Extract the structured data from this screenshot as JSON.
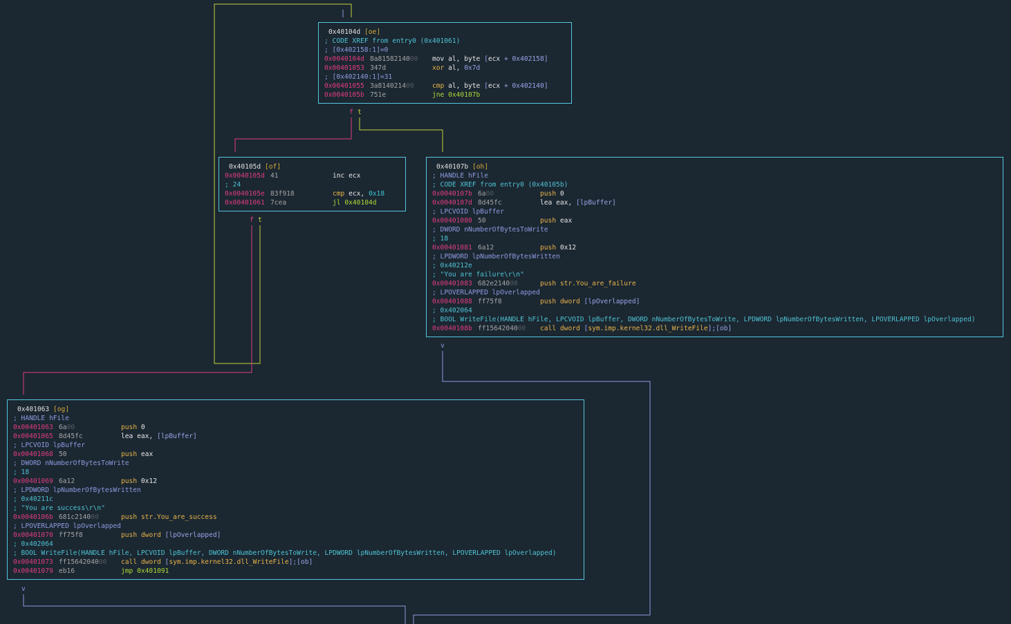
{
  "nodes": [
    {
      "id": "oe",
      "header": {
        "addr": "0x40104d",
        "label": "[oe]"
      },
      "lines": [
        {
          "t": "c",
          "text": "; CODE XREF from entry0 (0x401061)"
        },
        {
          "t": "c",
          "text": "; [0x402158:1]=0",
          "dim": true
        },
        {
          "t": "i",
          "off": "0x0040104d",
          "bytes": "8a81582140",
          "z": "00",
          "mn": "mov",
          "mcls": "op-w",
          "args": [
            [
              "al, byte ",
              "op-w"
            ],
            [
              "[",
              "br"
            ],
            [
              "ecx",
              "op-w"
            ],
            [
              " + ",
              "br"
            ],
            [
              "0x402158",
              "br"
            ],
            [
              "]",
              "br"
            ]
          ]
        },
        {
          "t": "i",
          "off": "0x00401053",
          "bytes": "347d",
          "z": "",
          "mn": "xor",
          "mcls": "op-y",
          "args": [
            [
              "al, ",
              "op-w"
            ],
            [
              "0x7d",
              "br"
            ]
          ]
        },
        {
          "t": "c",
          "text": "; [0x402140:1]=31",
          "dim": true
        },
        {
          "t": "i",
          "off": "0x00401055",
          "bytes": "3a8140214",
          "z": "00",
          "mn": "cmp",
          "mcls": "op-y",
          "args": [
            [
              "al, byte ",
              "op-w"
            ],
            [
              "[",
              "br"
            ],
            [
              "ecx",
              "op-w"
            ],
            [
              " + ",
              "br"
            ],
            [
              "0x402140",
              "br"
            ],
            [
              "]",
              "br"
            ]
          ]
        },
        {
          "t": "i",
          "off": "0x0040105b",
          "bytes": "751e",
          "z": "",
          "mn": "jne",
          "mcls": "op-g",
          "args": [
            [
              "0x40107b",
              "op-g"
            ]
          ]
        }
      ]
    },
    {
      "id": "of",
      "header": {
        "addr": "0x40105d",
        "label": "[of]"
      },
      "lines": [
        {
          "t": "i",
          "off": "0x0040105d",
          "bytes": "41",
          "z": "",
          "mn": "inc",
          "mcls": "op-w",
          "args": [
            [
              "ecx",
              "op-w"
            ]
          ]
        },
        {
          "t": "c",
          "text": "; 24"
        },
        {
          "t": "i",
          "off": "0x0040105e",
          "bytes": "83f918",
          "z": "",
          "mn": "cmp",
          "mcls": "op-y",
          "args": [
            [
              "ecx, ",
              "op-w"
            ],
            [
              "0x18",
              "num"
            ]
          ]
        },
        {
          "t": "i",
          "off": "0x00401061",
          "bytes": "7cea",
          "z": "",
          "mn": "jl",
          "mcls": "op-g",
          "args": [
            [
              "0x40104d",
              "op-g"
            ]
          ]
        }
      ]
    },
    {
      "id": "oh",
      "header": {
        "addr": "0x40107b",
        "label": "[oh]"
      },
      "lines": [
        {
          "t": "c",
          "text": "; HANDLE hFile",
          "dim": true
        },
        {
          "t": "c",
          "text": "; CODE XREF from entry0 (0x40105b)"
        },
        {
          "t": "i",
          "off": "0x0040107b",
          "bytes": "6a",
          "z": "00",
          "mn": "push",
          "mcls": "op-y",
          "args": [
            [
              "0",
              "op-w"
            ]
          ]
        },
        {
          "t": "i",
          "off": "0x0040107d",
          "bytes": "8d45fc",
          "z": "",
          "mn": "lea",
          "mcls": "op-w",
          "args": [
            [
              "eax, ",
              "op-w"
            ],
            [
              "[",
              "br"
            ],
            [
              "lpBuffer",
              "br"
            ],
            [
              "]",
              "br"
            ]
          ]
        },
        {
          "t": "c",
          "text": "; LPCVOID lpBuffer",
          "dim": true
        },
        {
          "t": "i",
          "off": "0x00401080",
          "bytes": "50",
          "z": "",
          "mn": "push",
          "mcls": "op-y",
          "args": [
            [
              "eax",
              "op-w"
            ]
          ]
        },
        {
          "t": "c",
          "text": "; DWORD nNumberOfBytesToWrite",
          "dim": true
        },
        {
          "t": "c",
          "text": "; 18"
        },
        {
          "t": "i",
          "off": "0x00401081",
          "bytes": "6a12",
          "z": "",
          "mn": "push",
          "mcls": "op-y",
          "args": [
            [
              "0x12",
              "op-w"
            ]
          ]
        },
        {
          "t": "c",
          "text": "; LPDWORD lpNumberOfBytesWritten",
          "dim": true
        },
        {
          "t": "c",
          "text": "; 0x40212e"
        },
        {
          "t": "c",
          "text": "; \"You are failure\\r\\n\""
        },
        {
          "t": "i",
          "off": "0x00401083",
          "bytes": "682e2140",
          "z": "00",
          "mn": "push",
          "mcls": "op-y",
          "args": [
            [
              "str.You_are_failure",
              "str"
            ]
          ]
        },
        {
          "t": "c",
          "text": "; LPOVERLAPPED lpOverlapped",
          "dim": true
        },
        {
          "t": "i",
          "off": "0x00401088",
          "bytes": "ff75f8",
          "z": "",
          "mn": "push",
          "mcls": "op-y",
          "args": [
            [
              "dword ",
              "op-y"
            ],
            [
              "[",
              "br"
            ],
            [
              "lpOverlapped",
              "br"
            ],
            [
              "]",
              "br"
            ]
          ]
        },
        {
          "t": "c",
          "text": "; 0x402064"
        },
        {
          "t": "c",
          "text": "; BOOL WriteFile(HANDLE hFile, LPCVOID lpBuffer, DWORD nNumberOfBytesToWrite, LPDWORD lpNumberOfBytesWritten, LPOVERLAPPED lpOverlapped)"
        },
        {
          "t": "i",
          "off": "0x0040108b",
          "bytes": "ff15642040",
          "z": "00",
          "mn": "call",
          "mcls": "op-y",
          "args": [
            [
              "dword ",
              "op-y"
            ],
            [
              "[",
              "br"
            ],
            [
              "sym.imp.kernel32.dll_WriteFile",
              "sym"
            ],
            [
              "];[ob]",
              "br"
            ]
          ]
        }
      ]
    },
    {
      "id": "og",
      "header": {
        "addr": "0x401063",
        "label": "[og]"
      },
      "lines": [
        {
          "t": "c",
          "text": "; HANDLE hFile",
          "dim": true
        },
        {
          "t": "i",
          "off": "0x00401063",
          "bytes": "6a",
          "z": "00",
          "mn": "push",
          "mcls": "op-y",
          "args": [
            [
              "0",
              "op-w"
            ]
          ]
        },
        {
          "t": "i",
          "off": "0x00401065",
          "bytes": "8d45fc",
          "z": "",
          "mn": "lea",
          "mcls": "op-w",
          "args": [
            [
              "eax, ",
              "op-w"
            ],
            [
              "[",
              "br"
            ],
            [
              "lpBuffer",
              "br"
            ],
            [
              "]",
              "br"
            ]
          ]
        },
        {
          "t": "c",
          "text": "; LPCVOID lpBuffer",
          "dim": true
        },
        {
          "t": "i",
          "off": "0x00401068",
          "bytes": "50",
          "z": "",
          "mn": "push",
          "mcls": "op-y",
          "args": [
            [
              "eax",
              "op-w"
            ]
          ]
        },
        {
          "t": "c",
          "text": "; DWORD nNumberOfBytesToWrite",
          "dim": true
        },
        {
          "t": "c",
          "text": "; 18"
        },
        {
          "t": "i",
          "off": "0x00401069",
          "bytes": "6a12",
          "z": "",
          "mn": "push",
          "mcls": "op-y",
          "args": [
            [
              "0x12",
              "op-w"
            ]
          ]
        },
        {
          "t": "c",
          "text": "; LPDWORD lpNumberOfBytesWritten",
          "dim": true
        },
        {
          "t": "c",
          "text": "; 0x40211c"
        },
        {
          "t": "c",
          "text": "; \"You are success\\r\\n\""
        },
        {
          "t": "i",
          "off": "0x0040106b",
          "bytes": "681c2140",
          "z": "00",
          "mn": "push",
          "mcls": "op-y",
          "args": [
            [
              "str.You_are_success",
              "str"
            ]
          ]
        },
        {
          "t": "c",
          "text": "; LPOVERLAPPED lpOverlapped",
          "dim": true
        },
        {
          "t": "i",
          "off": "0x00401070",
          "bytes": "ff75f8",
          "z": "",
          "mn": "push",
          "mcls": "op-y",
          "args": [
            [
              "dword ",
              "op-y"
            ],
            [
              "[",
              "br"
            ],
            [
              "lpOverlapped",
              "br"
            ],
            [
              "]",
              "br"
            ]
          ]
        },
        {
          "t": "c",
          "text": "; 0x402064"
        },
        {
          "t": "c",
          "text": "; BOOL WriteFile(HANDLE hFile, LPCVOID lpBuffer, DWORD nNumberOfBytesToWrite, LPDWORD lpNumberOfBytesWritten, LPOVERLAPPED lpOverlapped)"
        },
        {
          "t": "i",
          "off": "0x00401073",
          "bytes": "ff15642040",
          "z": "00",
          "mn": "call",
          "mcls": "op-y",
          "args": [
            [
              "dword ",
              "op-y"
            ],
            [
              "[",
              "br"
            ],
            [
              "sym.imp.kernel32.dll_WriteFile",
              "sym"
            ],
            [
              "];[ob]",
              "br"
            ]
          ]
        },
        {
          "t": "i",
          "off": "0x00401079",
          "bytes": "eb16",
          "z": "",
          "mn": "jmp",
          "mcls": "op-g",
          "args": [
            [
              "0x401091",
              "op-g"
            ]
          ]
        }
      ]
    }
  ],
  "edge_labels": {
    "false": "f",
    "true": "t",
    "down": "v"
  },
  "colors": {
    "background": "#1b2731",
    "node_border": "#55c8e0",
    "edge_true": "#c6d33a",
    "edge_false": "#e23c84",
    "edge_uncond": "#8f9be0"
  }
}
